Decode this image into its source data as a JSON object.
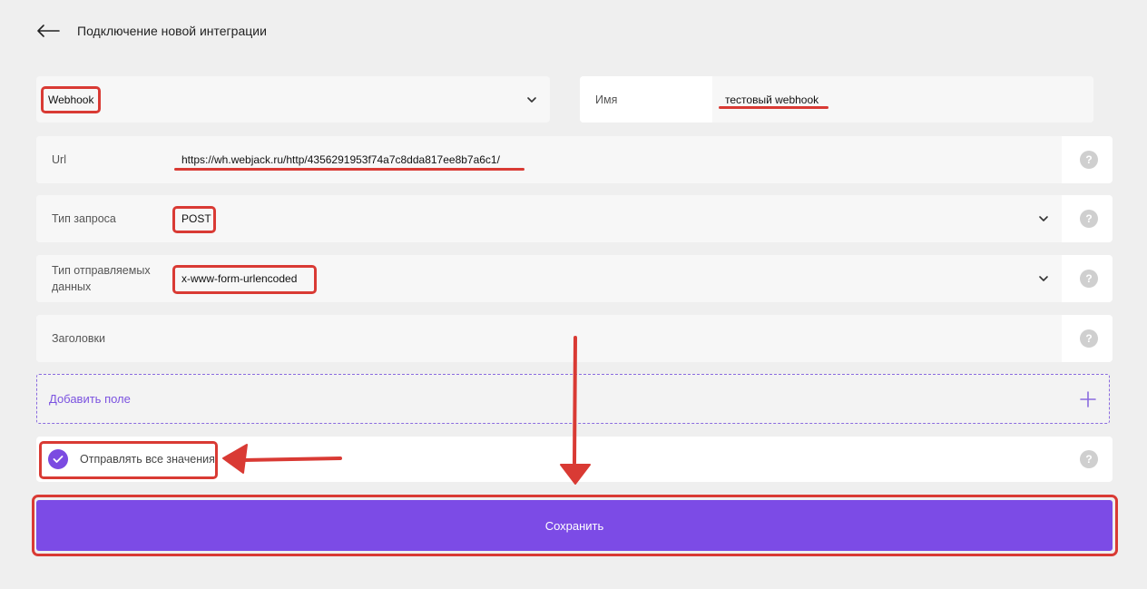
{
  "header": {
    "title": "Подключение новой интеграции",
    "back_icon": "arrow-left-icon"
  },
  "integration_type": {
    "selected": "Webhook"
  },
  "name_field": {
    "label": "Имя",
    "value": "тестовый webhook"
  },
  "url_field": {
    "label": "Url",
    "value": "https://wh.webjack.ru/http/4356291953f74a7c8dda817ee8b7a6c1/",
    "help": "?"
  },
  "request_type": {
    "label": "Тип запроса",
    "value": "POST",
    "help": "?"
  },
  "data_type": {
    "label": "Тип отправляемых данных",
    "value": "x-www-form-urlencoded",
    "help": "?"
  },
  "headers_field": {
    "label": "Заголовки",
    "value": "",
    "help": "?"
  },
  "add_field": {
    "label": "Добавить поле"
  },
  "send_all": {
    "label": "Отправлять все значения",
    "checked": true,
    "help": "?"
  },
  "save_button": {
    "label": "Сохранить"
  },
  "colors": {
    "accent": "#7c4be6",
    "annotation": "#d93a34",
    "background": "#efefef"
  }
}
